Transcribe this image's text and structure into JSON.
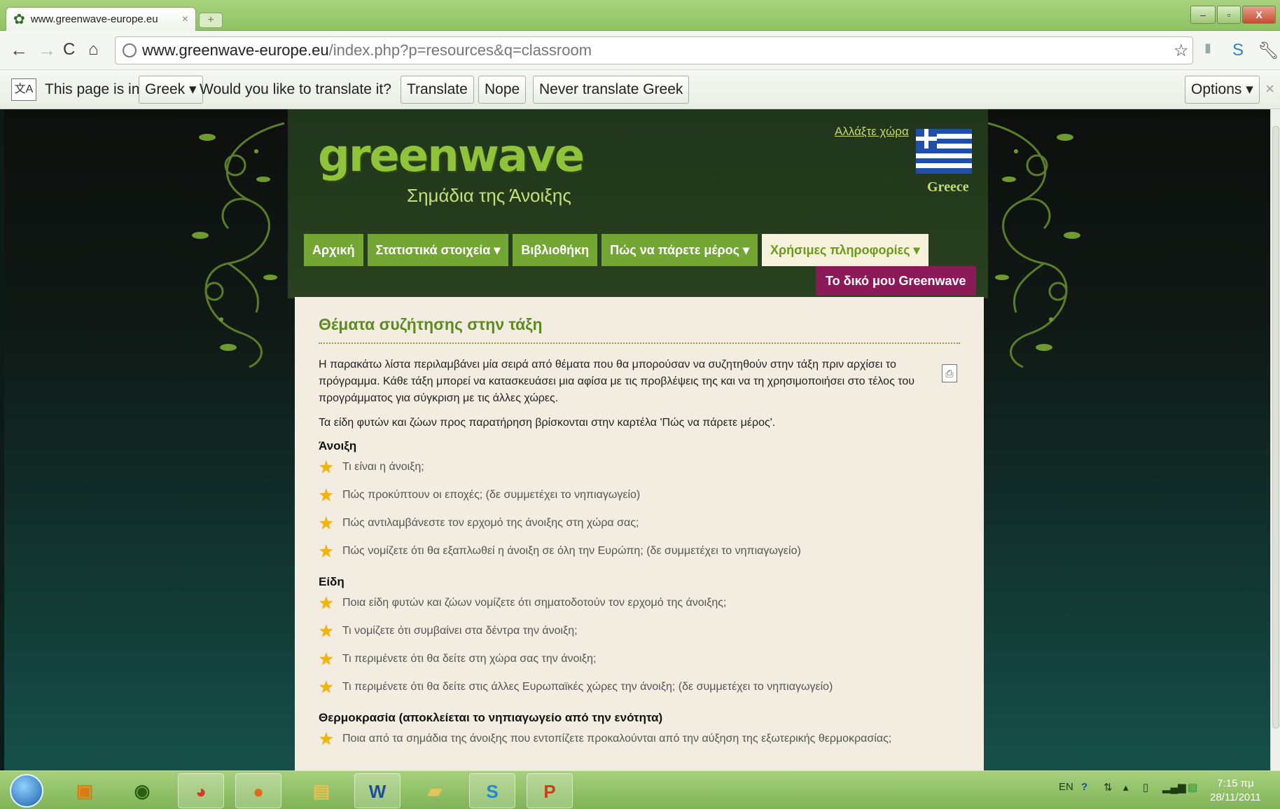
{
  "browser": {
    "tab_title": "www.greenwave-europe.eu",
    "tab_close": "×",
    "new_tab": "+",
    "url_host": "www.greenwave-europe.eu",
    "url_path": "/index.php?p=resources&q=classroom",
    "window_controls": [
      "–",
      "▫",
      "X"
    ]
  },
  "translate_bar": {
    "prefix": "This page is in",
    "language": "Greek",
    "question": "Would you like to translate it?",
    "translate": "Translate",
    "nope": "Nope",
    "never": "Never translate Greek",
    "options": "Options",
    "close": "×"
  },
  "site": {
    "logo": "greenwave",
    "tagline": "Σημάδια της Άνοιξης",
    "change_country": "Αλλάξτε χώρα",
    "country": "Greece",
    "menu": [
      {
        "label": "Αρχική"
      },
      {
        "label": "Στατιστικά στοιχεία ▾"
      },
      {
        "label": "Βιβλιοθήκη"
      },
      {
        "label": "Πώς να πάρετε μέρος ▾"
      },
      {
        "label": "Χρήσιμες πληροφορίες ▾"
      }
    ],
    "my_greenwave": "Το δικό μου Greenwave"
  },
  "content": {
    "title": "Θέματα συζήτησης στην τάξη",
    "intro": "Η παρακάτω λίστα περιλαμβάνει μία σειρά από θέματα που θα μπορούσαν να συζητηθούν στην τάξη πριν αρχίσει το πρόγραμμα. Κάθε τάξη μπορεί να κατασκευάσει μια αφίσα με τις προβλέψεις της και να τη χρησιμοποιήσει στο τέλος του προγράμματος για σύγκριση με τις άλλες χώρες.",
    "note": "Τα είδη φυτών και ζώων προς παρατήρηση βρίσκονται στην καρτέλα 'Πώς να πάρετε μέρος'.",
    "sections": [
      {
        "heading": "Άνοιξη",
        "items": [
          "Τι είναι η άνοιξη;",
          "Πώς προκύπτουν οι εποχές; (δε συμμετέχει το νηπιαγωγείο)",
          "Πώς αντιλαμβάνεστε τον ερχομό της άνοιξης στη χώρα σας;",
          "Πώς νομίζετε ότι θα εξαπλωθεί η άνοιξη σε όλη την Ευρώπη; (δε συμμετέχει το νηπιαγωγείο)"
        ]
      },
      {
        "heading": "Είδη",
        "items": [
          "Ποια είδη φυτών και ζώων νομίζετε ότι σηματοδοτούν τον ερχομό της άνοιξης;",
          "Τι νομίζετε ότι συμβαίνει στα δέντρα την άνοιξη;",
          "Τι περιμένετε ότι θα δείτε στη χώρα σας την άνοιξη;",
          "Τι περιμένετε ότι θα δείτε στις άλλες Ευρωπαϊκές χώρες την άνοιξη; (δε συμμετέχει το νηπιαγωγείο)"
        ]
      },
      {
        "heading": "Θερμοκρασία (αποκλείεται το νηπιαγωγείο από την ενότητα)",
        "items": [
          "Ποια από τα σημάδια της άνοιξης που εντοπίζετε προκαλούνται από την αύξηση της εξωτερικής θερμοκρασίας;"
        ]
      }
    ]
  },
  "taskbar": {
    "language": "EN",
    "time": "7:15 πμ",
    "date": "28/11/2011",
    "apps": [
      "media-player",
      "utorrent",
      "chrome",
      "firefox",
      "explorer",
      "word",
      "folder",
      "skype",
      "powerpoint"
    ],
    "app_glyphs": {
      "word": "W",
      "skype": "S",
      "powerpoint": "P"
    }
  },
  "colors": {
    "accent_green": "#74a634",
    "menu_active_bg": "#f6f1da",
    "my_greenwave_bg": "#8b1a59",
    "content_bg": "#f2ede0",
    "title_green": "#5f8a22",
    "star": "#f4b400"
  }
}
